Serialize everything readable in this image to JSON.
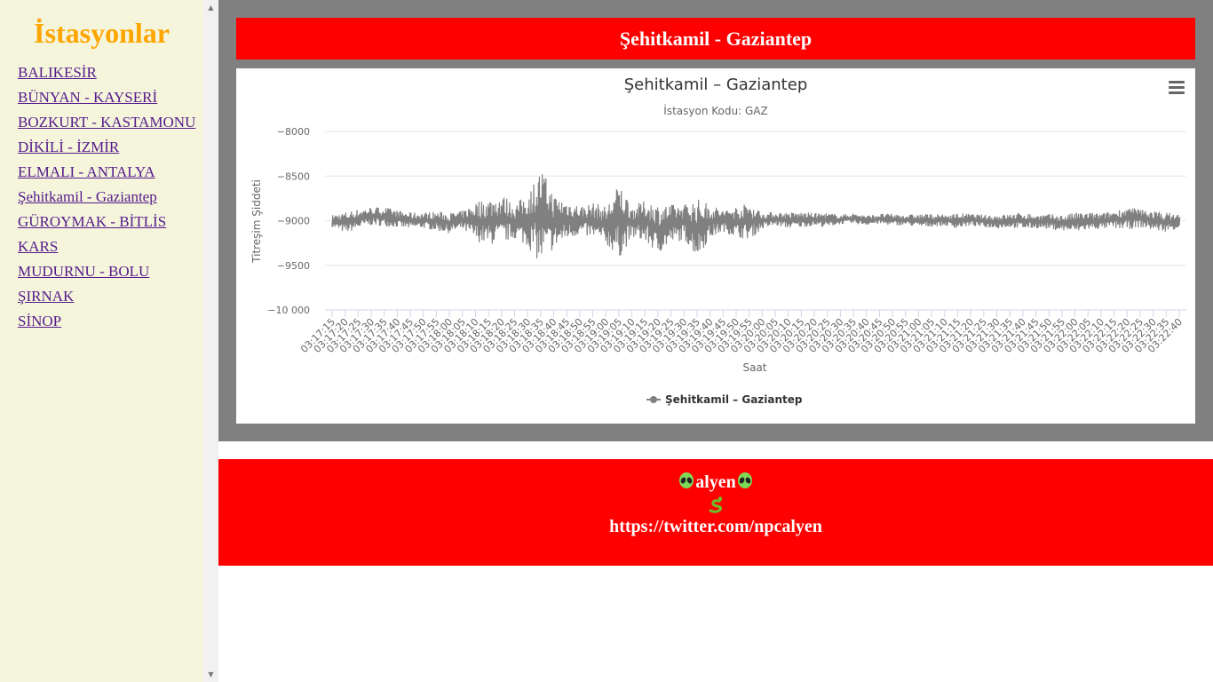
{
  "sidebar": {
    "title": "İstasyonlar",
    "stations": [
      "BALIKESİR",
      "BÜNYAN - KAYSERİ",
      "BOZKURT - KASTAMONU",
      "DİKİLİ - İZMİR",
      "ELMALI - ANTALYA",
      "Şehitkamil - Gaziantep",
      "GÜROYMAK - BİTLİS",
      "KARS",
      "MUDURNU - BOLU",
      "ŞIRNAK",
      "SİNOP"
    ]
  },
  "header": {
    "title": "Şehitkamil - Gaziantep"
  },
  "chart_data": {
    "type": "line",
    "title": "Şehitkamil – Gaziantep",
    "subtitle": "İstasyon Kodu: GAZ",
    "xlabel": "Saat",
    "ylabel": "Titreşim Şiddeti",
    "ylim": [
      -10000,
      -8000
    ],
    "yticks": [
      -8000,
      -8500,
      -9000,
      -9500,
      -10000
    ],
    "ytick_labels": [
      "−8000",
      "−8500",
      "−9000",
      "−9500",
      "−10 000"
    ],
    "x": [
      "03:17:15",
      "03:17:20",
      "03:17:25",
      "03:17:30",
      "03:17:35",
      "03:17:40",
      "03:17:45",
      "03:17:50",
      "03:17:55",
      "03:18:00",
      "03:18:05",
      "03:18:10",
      "03:18:15",
      "03:18:20",
      "03:18:25",
      "03:18:30",
      "03:18:35",
      "03:18:40",
      "03:18:45",
      "03:18:50",
      "03:18:55",
      "03:19:00",
      "03:19:05",
      "03:19:10",
      "03:19:15",
      "03:19:20",
      "03:19:25",
      "03:19:30",
      "03:19:35",
      "03:19:40",
      "03:19:45",
      "03:19:50",
      "03:19:55",
      "03:20:00",
      "03:20:05",
      "03:20:10",
      "03:20:15",
      "03:20:20",
      "03:20:25",
      "03:20:30",
      "03:20:35",
      "03:20:40",
      "03:20:45",
      "03:20:50",
      "03:20:55",
      "03:21:00",
      "03:21:05",
      "03:21:10",
      "03:21:15",
      "03:21:20",
      "03:21:25",
      "03:21:30",
      "03:21:35",
      "03:21:40",
      "03:21:45",
      "03:21:50",
      "03:21:55",
      "03:22:00",
      "03:22:05",
      "03:22:10",
      "03:22:15",
      "03:22:20",
      "03:22:25",
      "03:22:30",
      "03:22:35",
      "03:22:40"
    ],
    "series": [
      {
        "name": "Şehitkamil – Gaziantep",
        "color": "#808080",
        "min": [
          -9080,
          -9150,
          -9100,
          -9060,
          -9070,
          -9080,
          -9100,
          -9090,
          -9120,
          -9150,
          -9110,
          -9250,
          -9300,
          -9280,
          -9220,
          -9320,
          -9550,
          -9350,
          -9240,
          -9170,
          -9220,
          -9280,
          -9470,
          -9210,
          -9260,
          -9400,
          -9280,
          -9230,
          -9440,
          -9220,
          -9130,
          -9200,
          -9230,
          -9100,
          -9060,
          -9090,
          -9080,
          -9060,
          -9080,
          -9040,
          -9040,
          -9050,
          -9040,
          -9060,
          -9050,
          -9080,
          -9070,
          -9060,
          -9090,
          -9060,
          -9080,
          -9090,
          -9080,
          -9100,
          -9090,
          -9100,
          -9120,
          -9140,
          -9110,
          -9100,
          -9090,
          -9110,
          -9080,
          -9120,
          -9130,
          -9090
        ],
        "max": [
          -8930,
          -8890,
          -8860,
          -8840,
          -8840,
          -8880,
          -8900,
          -8900,
          -8890,
          -8900,
          -8880,
          -8760,
          -8720,
          -8680,
          -8800,
          -8650,
          -8350,
          -8680,
          -8750,
          -8820,
          -8780,
          -8820,
          -8530,
          -8820,
          -8750,
          -8790,
          -8800,
          -8790,
          -8720,
          -8800,
          -8870,
          -8820,
          -8780,
          -8900,
          -8900,
          -8900,
          -8900,
          -8910,
          -8910,
          -8930,
          -8910,
          -8940,
          -8920,
          -8920,
          -8930,
          -8920,
          -8920,
          -8930,
          -8910,
          -8920,
          -8930,
          -8930,
          -8920,
          -8900,
          -8930,
          -8920,
          -8930,
          -8900,
          -8900,
          -8910,
          -8880,
          -8840,
          -8860,
          -8880,
          -8900,
          -8920
        ]
      }
    ],
    "grid": true,
    "legend": "bottom-center"
  },
  "footer": {
    "name": "alyen",
    "url": "https://twitter.com/npcalyen"
  }
}
